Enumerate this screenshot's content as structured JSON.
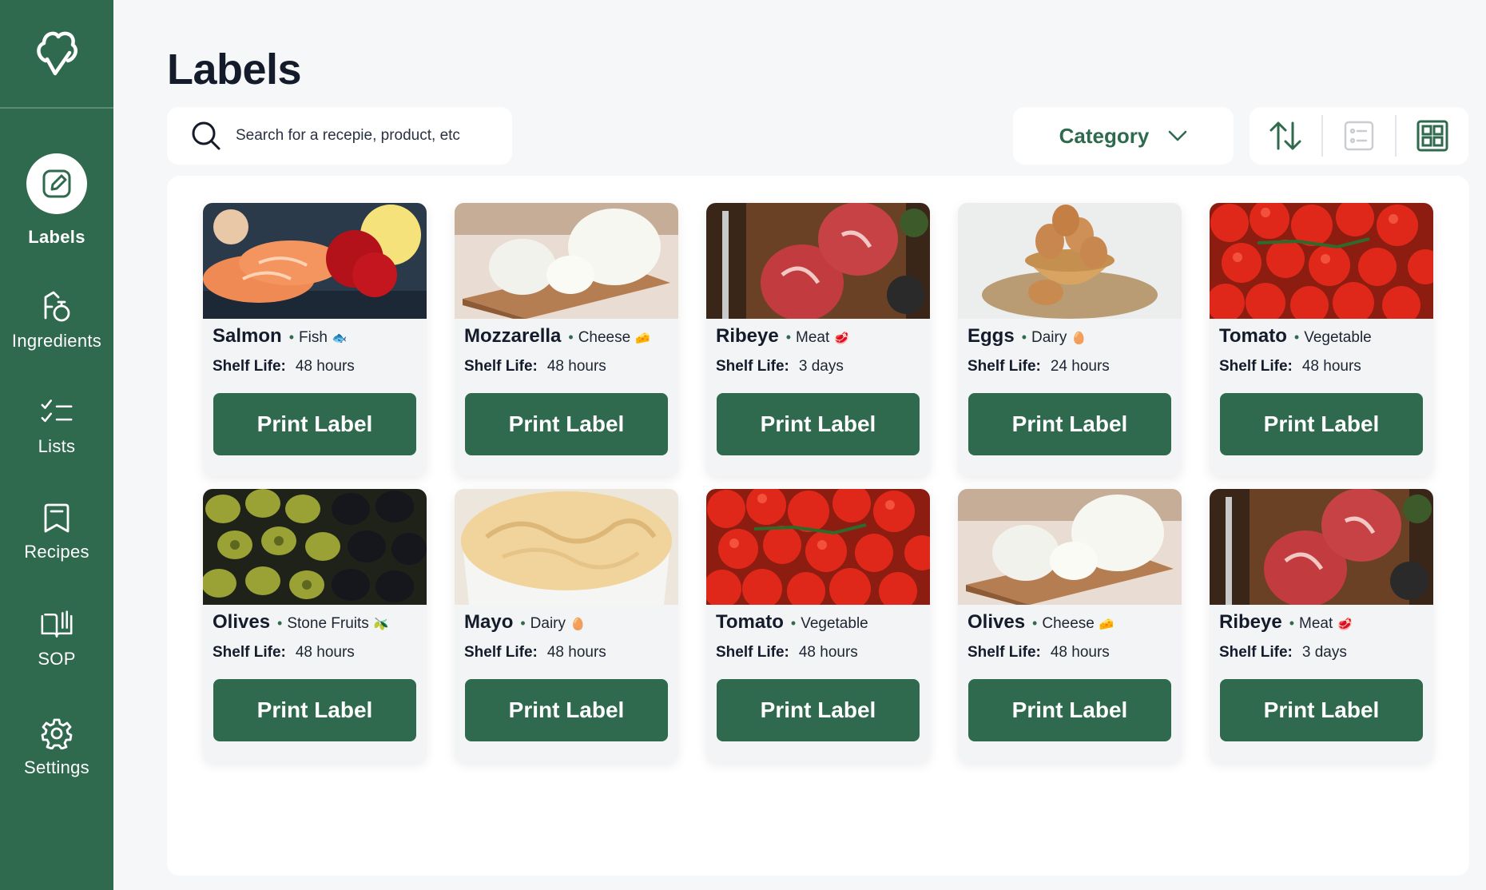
{
  "sidebar": {
    "items": [
      {
        "label": "Labels",
        "icon": "edit-icon",
        "active": true
      },
      {
        "label": "Ingredients",
        "icon": "ingredients-icon"
      },
      {
        "label": "Lists",
        "icon": "checklist-icon"
      },
      {
        "label": "Recipes",
        "icon": "bookmark-icon"
      },
      {
        "label": "SOP",
        "icon": "book-icon"
      },
      {
        "label": "Settings",
        "icon": "gear-icon"
      }
    ]
  },
  "page": {
    "title": "Labels"
  },
  "search": {
    "placeholder": "Search for a recepie, product, etc"
  },
  "filter": {
    "category_label": "Category"
  },
  "shelf_label": "Shelf Life:",
  "print_label": "Print Label",
  "colors": {
    "brand": "#2f6a4e",
    "background": "#f6f7f9",
    "card": "#f3f4f5"
  },
  "products": [
    {
      "name": "Salmon",
      "category": "Fish",
      "category_icon": "🐟",
      "shelf_life": "48 hours",
      "image": "salmon"
    },
    {
      "name": "Mozzarella",
      "category": "Cheese",
      "category_icon": "🧀",
      "shelf_life": "48 hours",
      "image": "mozzarella"
    },
    {
      "name": "Ribeye",
      "category": "Meat",
      "category_icon": "🥩",
      "shelf_life": "3 days",
      "image": "ribeye"
    },
    {
      "name": "Eggs",
      "category": "Dairy",
      "category_icon": "🥚",
      "shelf_life": "24 hours",
      "image": "eggs"
    },
    {
      "name": "Tomato",
      "category": "Vegetable",
      "category_icon": "",
      "shelf_life": "48 hours",
      "image": "tomato"
    },
    {
      "name": "Olives",
      "category": "Stone Fruits",
      "category_icon": "🫒",
      "shelf_life": "48 hours",
      "image": "olives"
    },
    {
      "name": "Mayo",
      "category": "Dairy",
      "category_icon": "🥚",
      "shelf_life": "48 hours",
      "image": "mayo"
    },
    {
      "name": "Tomato",
      "category": "Vegetable",
      "category_icon": "",
      "shelf_life": "48 hours",
      "image": "tomato"
    },
    {
      "name": "Olives",
      "category": "Cheese",
      "category_icon": "🧀",
      "shelf_life": "48 hours",
      "image": "mozzarella"
    },
    {
      "name": "Ribeye",
      "category": "Meat",
      "category_icon": "🥩",
      "shelf_life": "3 days",
      "image": "ribeye"
    }
  ]
}
